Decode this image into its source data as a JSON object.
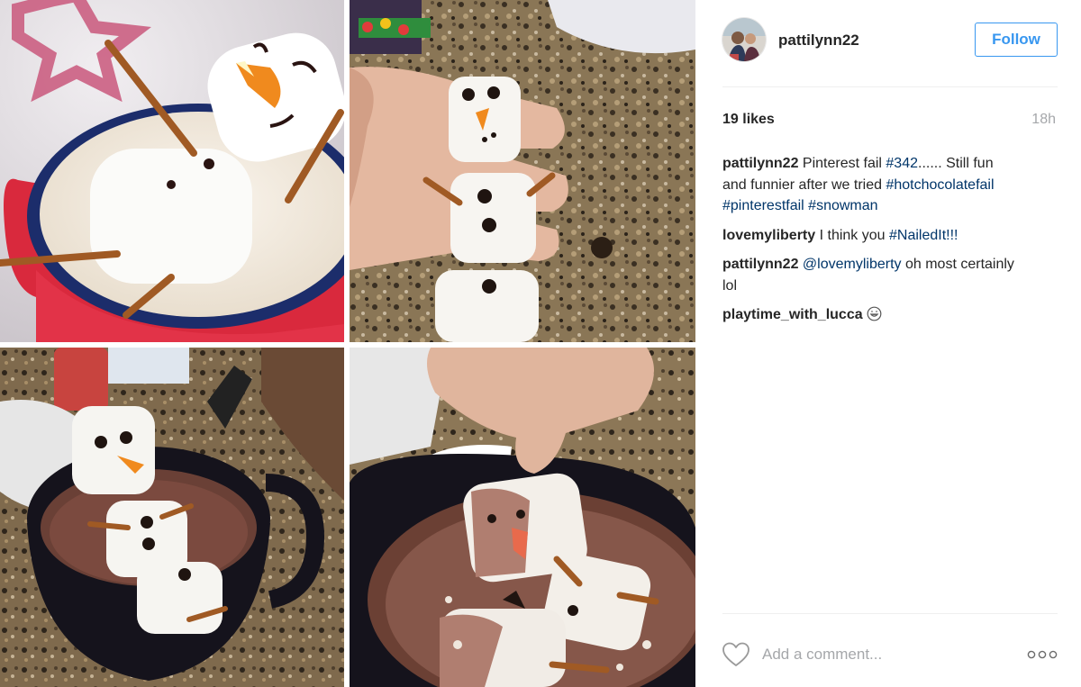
{
  "post": {
    "photo_tiles": [
      "marshmallow-snowman-mug",
      "marshmallow-snowman-hand",
      "snowman-in-cocoa-mug",
      "snowman-melting-in-cocoa"
    ]
  },
  "header": {
    "username": "pattilynn22",
    "avatar_icon": "profile-photo-avatar",
    "follow_label": "Follow",
    "accent_color": "#3897f0"
  },
  "stats": {
    "likes": "19 likes",
    "time": "18h"
  },
  "comments": [
    {
      "user": "pattilynn22",
      "parts": [
        {
          "type": "text",
          "value": " Pinterest fail "
        },
        {
          "type": "link",
          "value": "#342"
        },
        {
          "type": "text",
          "value": "...... Still fun and funnier after we tried "
        },
        {
          "type": "link",
          "value": "#hotchocolatefail"
        },
        {
          "type": "text",
          "value": " "
        },
        {
          "type": "link",
          "value": "#pinterestfail"
        },
        {
          "type": "text",
          "value": " "
        },
        {
          "type": "link",
          "value": "#snowman"
        }
      ]
    },
    {
      "user": "lovemyliberty",
      "parts": [
        {
          "type": "text",
          "value": " I think you "
        },
        {
          "type": "link",
          "value": "#NailedIt!!!"
        }
      ]
    },
    {
      "user": "pattilynn22",
      "parts": [
        {
          "type": "text",
          "value": " "
        },
        {
          "type": "link",
          "value": "@lovemyliberty"
        },
        {
          "type": "text",
          "value": " oh most certainly lol"
        }
      ]
    },
    {
      "user": "playtime_with_lucca",
      "parts": [
        {
          "type": "emoji",
          "value": "grinning-face-emoji"
        }
      ]
    }
  ],
  "footer": {
    "like_icon": "heart-outline-icon",
    "comment_placeholder": "Add a comment...",
    "more_icon": "more-options-icon"
  }
}
